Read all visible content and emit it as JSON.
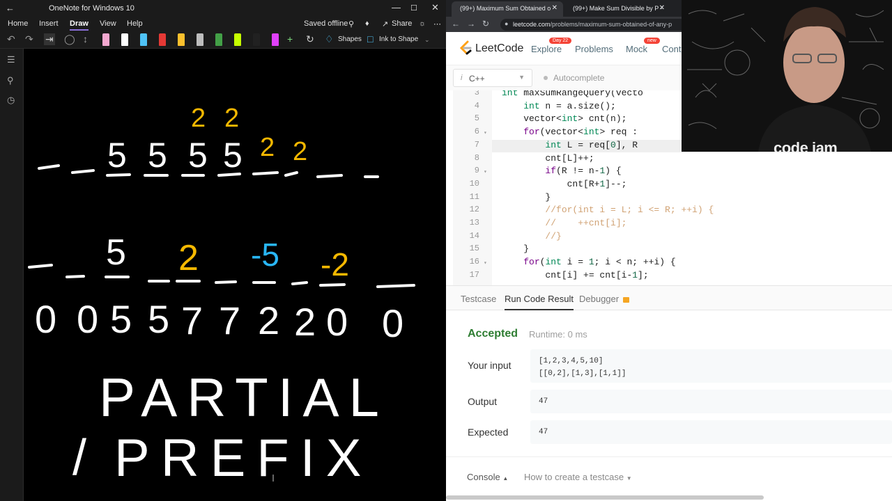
{
  "onenote": {
    "window_title": "OneNote for Windows 10",
    "ribbon_tabs": [
      "Home",
      "Insert",
      "Draw",
      "View",
      "Help"
    ],
    "active_tab": "Draw",
    "saved_status": "Saved offline",
    "share_label": "Share",
    "shapes_label": "Shapes",
    "ink_to_shape_label": "Ink to Shape",
    "pen_colors": [
      "#f5a8d0",
      "#ffffff",
      "#4fc3f7",
      "#e53935",
      "#fbc02d",
      "#bdbdbd",
      "#43a047",
      "#c6ff00",
      "#212121",
      "#e040fb"
    ],
    "ink": {
      "row1_top": [
        "2",
        "2",
        "2",
        "2"
      ],
      "row1_bottom": [
        "5",
        "5",
        "5",
        "5"
      ],
      "row2_values": [
        "5",
        "2",
        "-5",
        "-2"
      ],
      "row3_values": [
        "0",
        "0",
        "5",
        "5",
        "7",
        "7",
        "2",
        "2",
        "0",
        "0"
      ],
      "word1": "PARTIAL",
      "word2": "PREFIX",
      "slash": "/"
    },
    "ink_colors": {
      "white": "#ffffff",
      "orange": "#f5b800",
      "blue": "#29b6f6"
    }
  },
  "browser": {
    "tabs": [
      {
        "label": "(99+) Maximum Sum Obtained o",
        "active": true
      },
      {
        "label": "(99+) Make Sum Divisible by P -",
        "active": false
      }
    ],
    "url_host": "leetcode.com",
    "url_path": "/problems/maximum-sum-obtained-of-any-p"
  },
  "leetcode": {
    "brand": "LeetCode",
    "nav": [
      "Explore",
      "Problems",
      "Mock",
      "Cont"
    ],
    "explore_badge": "Day 22",
    "mock_badge": "new",
    "language": "C++",
    "autocomplete": "Autocomplete",
    "code_lines": [
      {
        "n": "3",
        "text": "int maxSumRangeQuery(vecto"
      },
      {
        "n": "4",
        "text": "    int n = a.size();"
      },
      {
        "n": "5",
        "text": "    vector<int> cnt(n);"
      },
      {
        "n": "6",
        "text": "    for(vector<int> req : "
      },
      {
        "n": "7",
        "text": "        int L = req[0], R"
      },
      {
        "n": "8",
        "text": "        cnt[L]++;"
      },
      {
        "n": "9",
        "text": "        if(R != n-1) {"
      },
      {
        "n": "10",
        "text": "            cnt[R+1]--;"
      },
      {
        "n": "11",
        "text": "        }"
      },
      {
        "n": "12",
        "text": "        //for(int i = L; i <= R; ++i) {"
      },
      {
        "n": "13",
        "text": "        //    ++cnt[i];"
      },
      {
        "n": "14",
        "text": "        //}"
      },
      {
        "n": "15",
        "text": "    }"
      },
      {
        "n": "16",
        "text": "    for(int i = 1; i < n; ++i) {"
      },
      {
        "n": "17",
        "text": "        cnt[i] += cnt[i-1];"
      }
    ],
    "result_tabs": [
      "Testcase",
      "Run Code Result",
      "Debugger"
    ],
    "active_result_tab": "Run Code Result",
    "status": "Accepted",
    "runtime": "Runtime: 0 ms",
    "input_label": "Your input",
    "input_value": "[1,2,3,4,5,10]\n[[0,2],[1,3],[1,1]]",
    "output_label": "Output",
    "output_value": "47",
    "expected_label": "Expected",
    "expected_value": "47",
    "console_label": "Console",
    "how_to_label": "How to create a testcase"
  },
  "webcam": {
    "brand": "code jam"
  }
}
